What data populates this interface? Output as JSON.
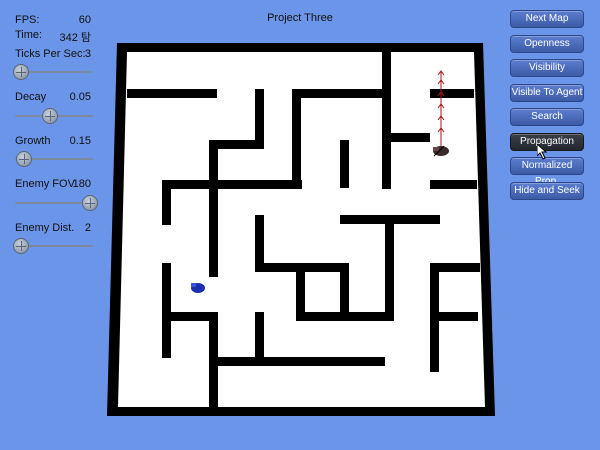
{
  "title": "Project Three",
  "stats": {
    "fps_label": "FPS:",
    "fps_value": "60",
    "time_label": "Time:",
    "time_value": "342 탐"
  },
  "sliders": [
    {
      "label": "Ticks Per Sec:",
      "value": "3",
      "level": 0.08
    },
    {
      "label": "Decay",
      "value": "0.05",
      "level": 0.45
    },
    {
      "label": "Growth",
      "value": "0.15",
      "level": 0.12
    },
    {
      "label": "Enemy FOV",
      "value": "180",
      "level": 0.96
    },
    {
      "label": "Enemy Dist.",
      "value": "2",
      "level": 0.08
    }
  ],
  "buttons": [
    {
      "label": "Next Map",
      "active": false
    },
    {
      "label": "Openness",
      "active": false
    },
    {
      "label": "Visibility",
      "active": false
    },
    {
      "label": "Visible To Agent",
      "active": false
    },
    {
      "label": "Search",
      "active": false
    },
    {
      "label": "Propagation",
      "active": true
    },
    {
      "label": "Normalized Prop.",
      "active": false
    },
    {
      "label": "Hide and Seek",
      "active": false
    }
  ],
  "colors": {
    "background": "#6b95e8",
    "maze_floor": "#ffffff",
    "maze_wall": "#000000",
    "agent": "#1a2fb0",
    "enemy": "#3a2a2a",
    "path": "#b01010"
  },
  "icons": [
    "agent-icon",
    "enemy-icon",
    "cursor-icon"
  ]
}
